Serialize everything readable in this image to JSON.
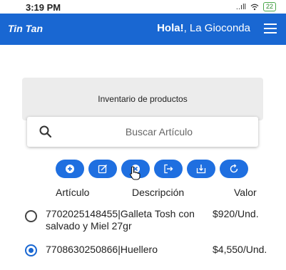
{
  "status_bar": {
    "time": "3:19 PM",
    "signal": "..ıll",
    "wifi_icon": "wifi-icon",
    "battery": "22"
  },
  "navbar": {
    "brand": "Tin Tan",
    "greeting_prefix": "Hola!",
    "greeting_name": ", La Gioconda",
    "menu_icon": "hamburger-menu-icon",
    "color": "#1967d2"
  },
  "page": {
    "title": "Inventario de productos"
  },
  "search": {
    "placeholder": "Buscar Artículo",
    "value": ""
  },
  "toolbar": {
    "buttons": [
      {
        "icon": "add-circle-icon"
      },
      {
        "icon": "edit-icon"
      },
      {
        "icon": "delete-circle-icon"
      },
      {
        "icon": "exit-icon"
      },
      {
        "icon": "download-icon"
      },
      {
        "icon": "refresh-icon"
      }
    ],
    "color": "#1f6fe0"
  },
  "table": {
    "columns": [
      "Artículo",
      "Descripción",
      "Valor"
    ],
    "rows": [
      {
        "selected": false,
        "description": "7702025148455|Galleta Tosh con salvado y Miel 27gr",
        "price": "$920/Und."
      },
      {
        "selected": true,
        "description": "7708630250866|Huellero",
        "price": "$4,550/Und."
      }
    ]
  }
}
